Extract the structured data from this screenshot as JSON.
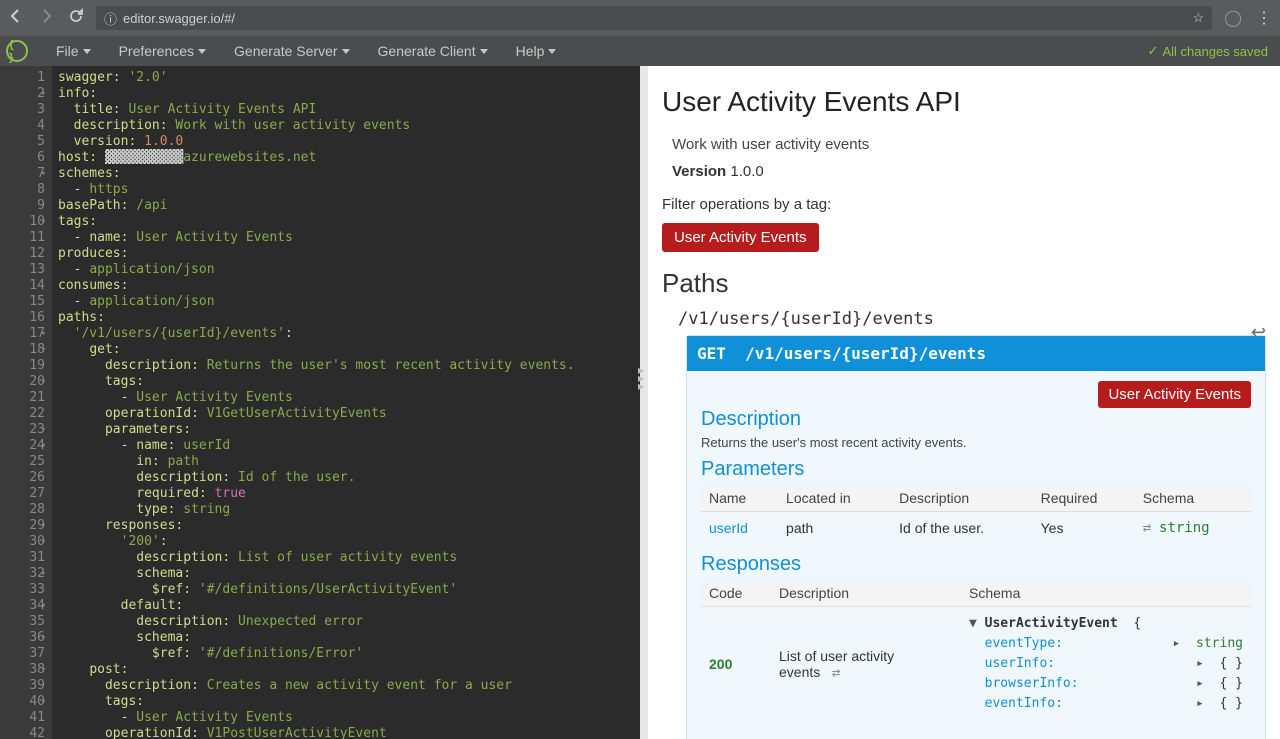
{
  "browser": {
    "url": "editor.swagger.io/#/"
  },
  "menu": {
    "items": [
      "File",
      "Preferences",
      "Generate Server",
      "Generate Client",
      "Help"
    ],
    "save_status": "All changes saved"
  },
  "api": {
    "title": "User Activity Events API",
    "description": "Work with user activity events",
    "version_label": "Version",
    "version": "1.0.0",
    "filter_label": "Filter operations by a tag:",
    "tag": "User Activity Events",
    "paths_heading": "Paths",
    "path": "/v1/users/{userId}/events",
    "op": {
      "method": "GET",
      "path": "/v1/users/{userId}/events",
      "tag": "User Activity Events",
      "desc_h": "Description",
      "desc": "Returns the user's most recent activity events.",
      "params_h": "Parameters",
      "param_headers": [
        "Name",
        "Located in",
        "Description",
        "Required",
        "Schema"
      ],
      "param": {
        "name": "userId",
        "in": "path",
        "desc": "Id of the user.",
        "required": "Yes",
        "type": "string"
      },
      "resp_h": "Responses",
      "resp_headers": [
        "Code",
        "Description",
        "Schema"
      ],
      "resp": {
        "code": "200",
        "desc": "List of user activity events",
        "schema_name": "UserActivityEvent",
        "fields": [
          {
            "name": "eventType:",
            "type": "string"
          },
          {
            "name": "userInfo:",
            "type": "{ }"
          },
          {
            "name": "browserInfo:",
            "type": "{ }"
          },
          {
            "name": "eventInfo:",
            "type": "{ }"
          }
        ]
      }
    }
  },
  "code_lines": [
    [
      [
        "k",
        "swagger:"
      ],
      [
        "d",
        " "
      ],
      [
        "s",
        "'2.0'"
      ]
    ],
    [
      [
        "k",
        "info:"
      ]
    ],
    [
      [
        "d",
        "  "
      ],
      [
        "k",
        "title:"
      ],
      [
        "d",
        " "
      ],
      [
        "s",
        "User Activity Events API"
      ]
    ],
    [
      [
        "d",
        "  "
      ],
      [
        "k",
        "description:"
      ],
      [
        "d",
        " "
      ],
      [
        "s",
        "Work with user activity events"
      ]
    ],
    [
      [
        "d",
        "  "
      ],
      [
        "k",
        "version:"
      ],
      [
        "d",
        " "
      ],
      [
        "n",
        "1.0.0"
      ]
    ],
    [
      [
        "k",
        "host:"
      ],
      [
        "d",
        " "
      ],
      [
        "d",
        "▓▓▓▓▓▓▓▓▓▓"
      ],
      [
        "s",
        "azurewebsites.net"
      ]
    ],
    [
      [
        "k",
        "schemes:"
      ]
    ],
    [
      [
        "d",
        "  - "
      ],
      [
        "s",
        "https"
      ]
    ],
    [
      [
        "k",
        "basePath:"
      ],
      [
        "d",
        " "
      ],
      [
        "s",
        "/api"
      ]
    ],
    [
      [
        "k",
        "tags:"
      ]
    ],
    [
      [
        "d",
        "  - "
      ],
      [
        "k",
        "name:"
      ],
      [
        "d",
        " "
      ],
      [
        "s",
        "User Activity Events"
      ]
    ],
    [
      [
        "k",
        "produces:"
      ]
    ],
    [
      [
        "d",
        "  - "
      ],
      [
        "s",
        "application/json"
      ]
    ],
    [
      [
        "k",
        "consumes:"
      ]
    ],
    [
      [
        "d",
        "  - "
      ],
      [
        "s",
        "application/json"
      ]
    ],
    [
      [
        "k",
        "paths:"
      ]
    ],
    [
      [
        "d",
        "  "
      ],
      [
        "s",
        "'/v1/users/{userId}/events'"
      ],
      [
        "k",
        ":"
      ]
    ],
    [
      [
        "d",
        "    "
      ],
      [
        "k",
        "get:"
      ]
    ],
    [
      [
        "d",
        "      "
      ],
      [
        "k",
        "description:"
      ],
      [
        "d",
        " "
      ],
      [
        "s",
        "Returns the user's most recent activity events."
      ]
    ],
    [
      [
        "d",
        "      "
      ],
      [
        "k",
        "tags:"
      ]
    ],
    [
      [
        "d",
        "        - "
      ],
      [
        "s",
        "User Activity Events"
      ]
    ],
    [
      [
        "d",
        "      "
      ],
      [
        "k",
        "operationId:"
      ],
      [
        "d",
        " "
      ],
      [
        "s",
        "V1GetUserActivityEvents"
      ]
    ],
    [
      [
        "d",
        "      "
      ],
      [
        "k",
        "parameters:"
      ]
    ],
    [
      [
        "d",
        "        - "
      ],
      [
        "k",
        "name:"
      ],
      [
        "d",
        " "
      ],
      [
        "s",
        "userId"
      ]
    ],
    [
      [
        "d",
        "          "
      ],
      [
        "k",
        "in:"
      ],
      [
        "d",
        " "
      ],
      [
        "s",
        "path"
      ]
    ],
    [
      [
        "d",
        "          "
      ],
      [
        "k",
        "description:"
      ],
      [
        "d",
        " "
      ],
      [
        "s",
        "Id of the user."
      ]
    ],
    [
      [
        "d",
        "          "
      ],
      [
        "k",
        "required:"
      ],
      [
        "d",
        " "
      ],
      [
        "b",
        "true"
      ]
    ],
    [
      [
        "d",
        "          "
      ],
      [
        "k",
        "type:"
      ],
      [
        "d",
        " "
      ],
      [
        "s",
        "string"
      ]
    ],
    [
      [
        "d",
        "      "
      ],
      [
        "k",
        "responses:"
      ]
    ],
    [
      [
        "d",
        "        "
      ],
      [
        "s",
        "'200'"
      ],
      [
        "k",
        ":"
      ]
    ],
    [
      [
        "d",
        "          "
      ],
      [
        "k",
        "description:"
      ],
      [
        "d",
        " "
      ],
      [
        "s",
        "List of user activity events"
      ]
    ],
    [
      [
        "d",
        "          "
      ],
      [
        "k",
        "schema:"
      ]
    ],
    [
      [
        "d",
        "            "
      ],
      [
        "k",
        "$ref:"
      ],
      [
        "d",
        " "
      ],
      [
        "s",
        "'#/definitions/UserActivityEvent'"
      ]
    ],
    [
      [
        "d",
        "        "
      ],
      [
        "k",
        "default:"
      ]
    ],
    [
      [
        "d",
        "          "
      ],
      [
        "k",
        "description:"
      ],
      [
        "d",
        " "
      ],
      [
        "s",
        "Unexpected error"
      ]
    ],
    [
      [
        "d",
        "          "
      ],
      [
        "k",
        "schema:"
      ]
    ],
    [
      [
        "d",
        "            "
      ],
      [
        "k",
        "$ref:"
      ],
      [
        "d",
        " "
      ],
      [
        "s",
        "'#/definitions/Error'"
      ]
    ],
    [
      [
        "d",
        "    "
      ],
      [
        "k",
        "post:"
      ]
    ],
    [
      [
        "d",
        "      "
      ],
      [
        "k",
        "description:"
      ],
      [
        "d",
        " "
      ],
      [
        "s",
        "Creates a new activity event for a user"
      ]
    ],
    [
      [
        "d",
        "      "
      ],
      [
        "k",
        "tags:"
      ]
    ],
    [
      [
        "d",
        "        - "
      ],
      [
        "s",
        "User Activity Events"
      ]
    ],
    [
      [
        "d",
        "      "
      ],
      [
        "k",
        "operationId:"
      ],
      [
        "d",
        " "
      ],
      [
        "s",
        "V1PostUserActivityEvent"
      ]
    ]
  ],
  "fold_lines": [
    2,
    7,
    10,
    17,
    18,
    20,
    23,
    24,
    29,
    30,
    32,
    34,
    36,
    38,
    40
  ]
}
